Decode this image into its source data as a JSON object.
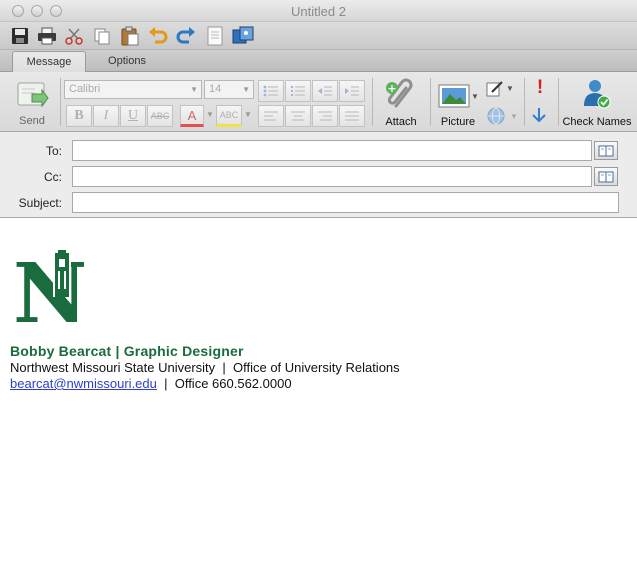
{
  "window": {
    "title": "Untitled 2"
  },
  "icons": {
    "toolbar": [
      "save-icon",
      "print-icon",
      "cut-icon",
      "copy-icon",
      "paste-icon",
      "undo-icon",
      "redo-icon",
      "document-icon",
      "media-browser-icon"
    ],
    "ribbon": [
      "send-icon",
      "attach-paperclip-icon",
      "picture-icon",
      "signature-icon",
      "globe-icon",
      "high-importance-icon",
      "low-importance-icon",
      "check-names-icon"
    ]
  },
  "tabs": [
    {
      "label": "Message",
      "active": true
    },
    {
      "label": "Options",
      "active": false
    }
  ],
  "ribbon": {
    "send_label": "Send",
    "font_name": "Calibri",
    "font_size": "14",
    "bold": "B",
    "italic": "I",
    "underline": "U",
    "strikethrough": "ABC",
    "highlight": "ABC",
    "font_color": "A",
    "attach_label": "Attach",
    "picture_label": "Picture",
    "high_importance": "!",
    "check_names_label": "Check Names"
  },
  "header": {
    "to_label": "To:",
    "to_value": "",
    "cc_label": "Cc:",
    "cc_value": "",
    "subject_label": "Subject:",
    "subject_value": ""
  },
  "signature": {
    "logo_letter": "N",
    "name_title": "Bobby Bearcat | Graphic Designer",
    "org_line": "Northwest Missouri State University  |  Office of University Relations",
    "email": "bearcat@nwmissouri.edu",
    "separator": "  |  ",
    "phone": "Office 660.562.0000"
  },
  "colors": {
    "brand_green": "#1a6b3d",
    "link_blue": "#2a3fcc",
    "importance_red": "#d8201c",
    "importance_blue": "#2e7fd0"
  }
}
